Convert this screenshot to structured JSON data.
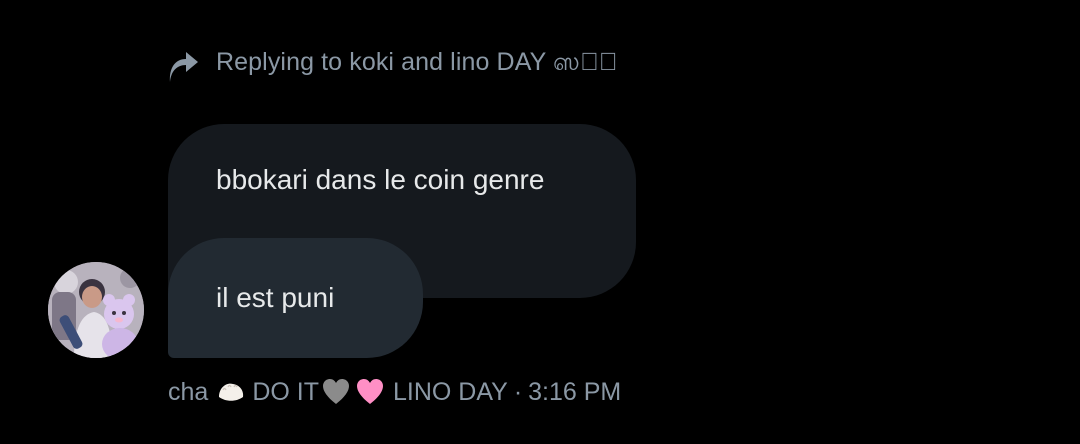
{
  "reply_context": {
    "text": "Replying to koki and lino DAY ஸ♡ி"
  },
  "messages": [
    {
      "text": "bbokari dans le coin genre"
    },
    {
      "text": "il est puni"
    }
  ],
  "sender": {
    "name_prefix": "cha",
    "name_middle": "DO IT",
    "name_suffix": "LINO DAY",
    "separator": "·",
    "time": "3:16 PM"
  },
  "icons": {
    "reply": "reply-arrow-icon",
    "dumpling": "dumpling-emoji-icon",
    "grey_heart": "grey-heart-emoji-icon",
    "pink_heart": "pink-heart-emoji-icon"
  },
  "colors": {
    "background": "#000000",
    "secondary_text": "#8b98a5",
    "message_text": "#e7e9ea",
    "bubble_first": "#15191e",
    "bubble_second": "#222a32"
  }
}
